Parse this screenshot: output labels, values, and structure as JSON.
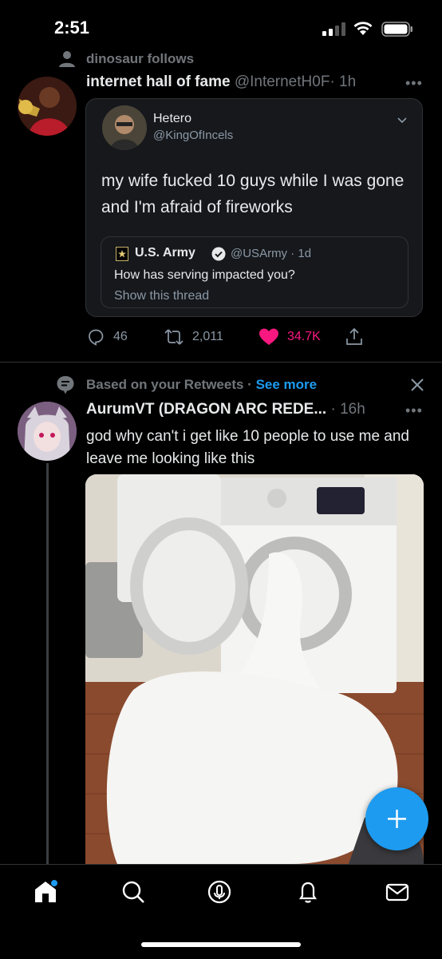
{
  "status_bar": {
    "time": "2:51"
  },
  "tweet1": {
    "social_context": "dinosaur follows",
    "author_name": "internet hall of fame",
    "author_handle": "@InternetH0F",
    "time": "· 1h",
    "more": "•••",
    "quote": {
      "name": "Hetero",
      "handle": "@KingOfIncels",
      "text": "my wife fucked 10 guys while I was gone and I'm afraid of fireworks",
      "inner": {
        "name": "U.S. Army",
        "handle": "@USArmy · 1d",
        "text": "How has serving impacted you?",
        "show_thread": "Show this thread"
      }
    },
    "replies": "46",
    "retweets": "2,011",
    "likes": "34.7K"
  },
  "tweet2": {
    "context": "Based on your Retweets ·",
    "see_more": "See more",
    "author_name": "AurumVT (DRAGON ARC REDE...",
    "time": "· 16h",
    "more": "•••",
    "text": "god why can't i get like 10 people to use me and leave me looking like this"
  },
  "colors": {
    "accent": "#1d9bf0",
    "like": "#f91880",
    "muted": "#71767b",
    "background": "#000000"
  },
  "icons": [
    "person-icon",
    "reply-icon",
    "retweet-icon",
    "heart-icon",
    "share-icon",
    "verified-icon",
    "plus-icon",
    "home-icon",
    "search-icon",
    "spaces-icon",
    "bell-icon",
    "mail-icon"
  ]
}
